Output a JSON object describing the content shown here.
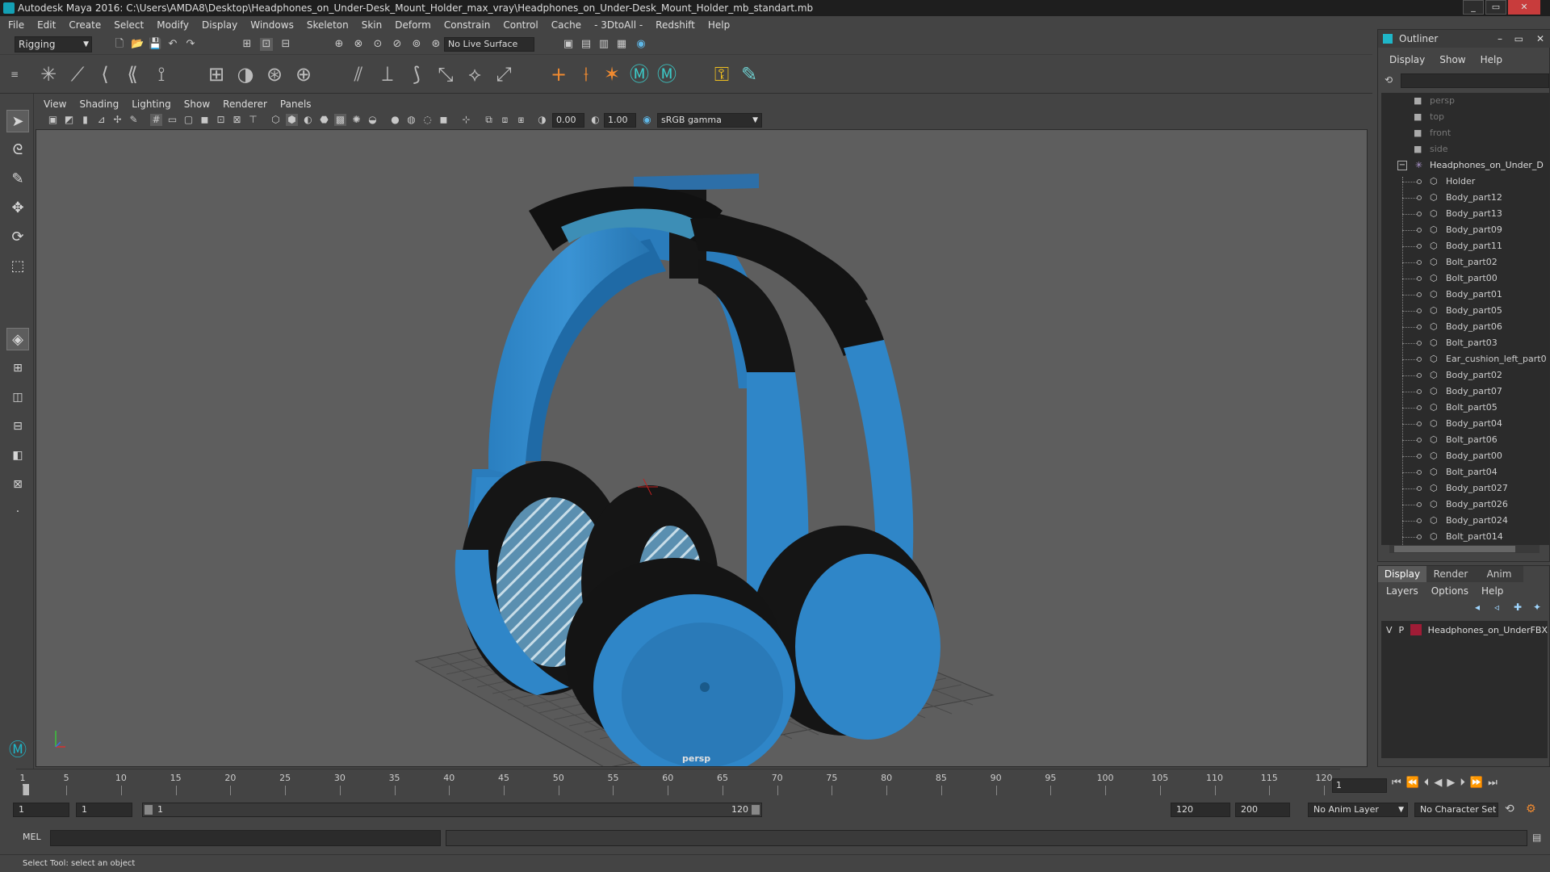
{
  "window": {
    "title": "Autodesk Maya 2016: C:\\Users\\AMDA8\\Desktop\\Headphones_on_Under-Desk_Mount_Holder_max_vray\\Headphones_on_Under-Desk_Mount_Holder_mb_standart.mb"
  },
  "menubar": [
    "File",
    "Edit",
    "Create",
    "Select",
    "Modify",
    "Display",
    "Windows",
    "Skeleton",
    "Skin",
    "Deform",
    "Constrain",
    "Control",
    "Cache",
    "- 3DtoAll -",
    "Redshift",
    "Help"
  ],
  "statusline": {
    "mode": "Rigging",
    "live_surface": "No Live Surface"
  },
  "panel": {
    "menu": [
      "View",
      "Shading",
      "Lighting",
      "Show",
      "Renderer",
      "Panels"
    ],
    "exposure": "0.00",
    "gamma": "1.00",
    "color_space": "sRGB gamma",
    "camera": "persp"
  },
  "outliner": {
    "title": "Outliner",
    "menu": [
      "Display",
      "Show",
      "Help"
    ],
    "cameras": [
      "persp",
      "top",
      "front",
      "side"
    ],
    "group": "Headphones_on_Under_D",
    "children": [
      "Holder",
      "Body_part12",
      "Body_part13",
      "Body_part09",
      "Body_part11",
      "Bolt_part02",
      "Bolt_part00",
      "Body_part01",
      "Body_part05",
      "Body_part06",
      "Bolt_part03",
      "Ear_cushion_left_part0",
      "Body_part02",
      "Body_part07",
      "Bolt_part05",
      "Body_part04",
      "Bolt_part06",
      "Body_part00",
      "Bolt_part04",
      "Body_part027",
      "Body_part026",
      "Body_part024",
      "Bolt_part014"
    ]
  },
  "layer_editor": {
    "tabs": [
      "Display",
      "Render",
      "Anim"
    ],
    "menu": [
      "Layers",
      "Options",
      "Help"
    ],
    "layer": {
      "v": "V",
      "p": "P",
      "name": "Headphones_on_UnderFBX",
      "color": "#a01c36"
    }
  },
  "timeline": {
    "ticks": [
      1,
      5,
      10,
      15,
      20,
      25,
      30,
      35,
      40,
      45,
      50,
      55,
      60,
      65,
      70,
      75,
      80,
      85,
      90,
      95,
      100,
      105,
      110,
      115,
      120
    ],
    "current_frame": "1"
  },
  "range": {
    "start": "1",
    "start_inner": "1",
    "slider_start": "1",
    "slider_end": "120",
    "end_inner": "120",
    "end": "200",
    "anim_layer": "No Anim Layer",
    "char_set": "No Character Set"
  },
  "cmdline": {
    "label": "MEL"
  },
  "helpline": "Select Tool: select an object",
  "colors": {
    "headphone_blue": "#2f86c8",
    "cushion_black": "#151515",
    "viewport_bg": "#5e5e5e"
  }
}
